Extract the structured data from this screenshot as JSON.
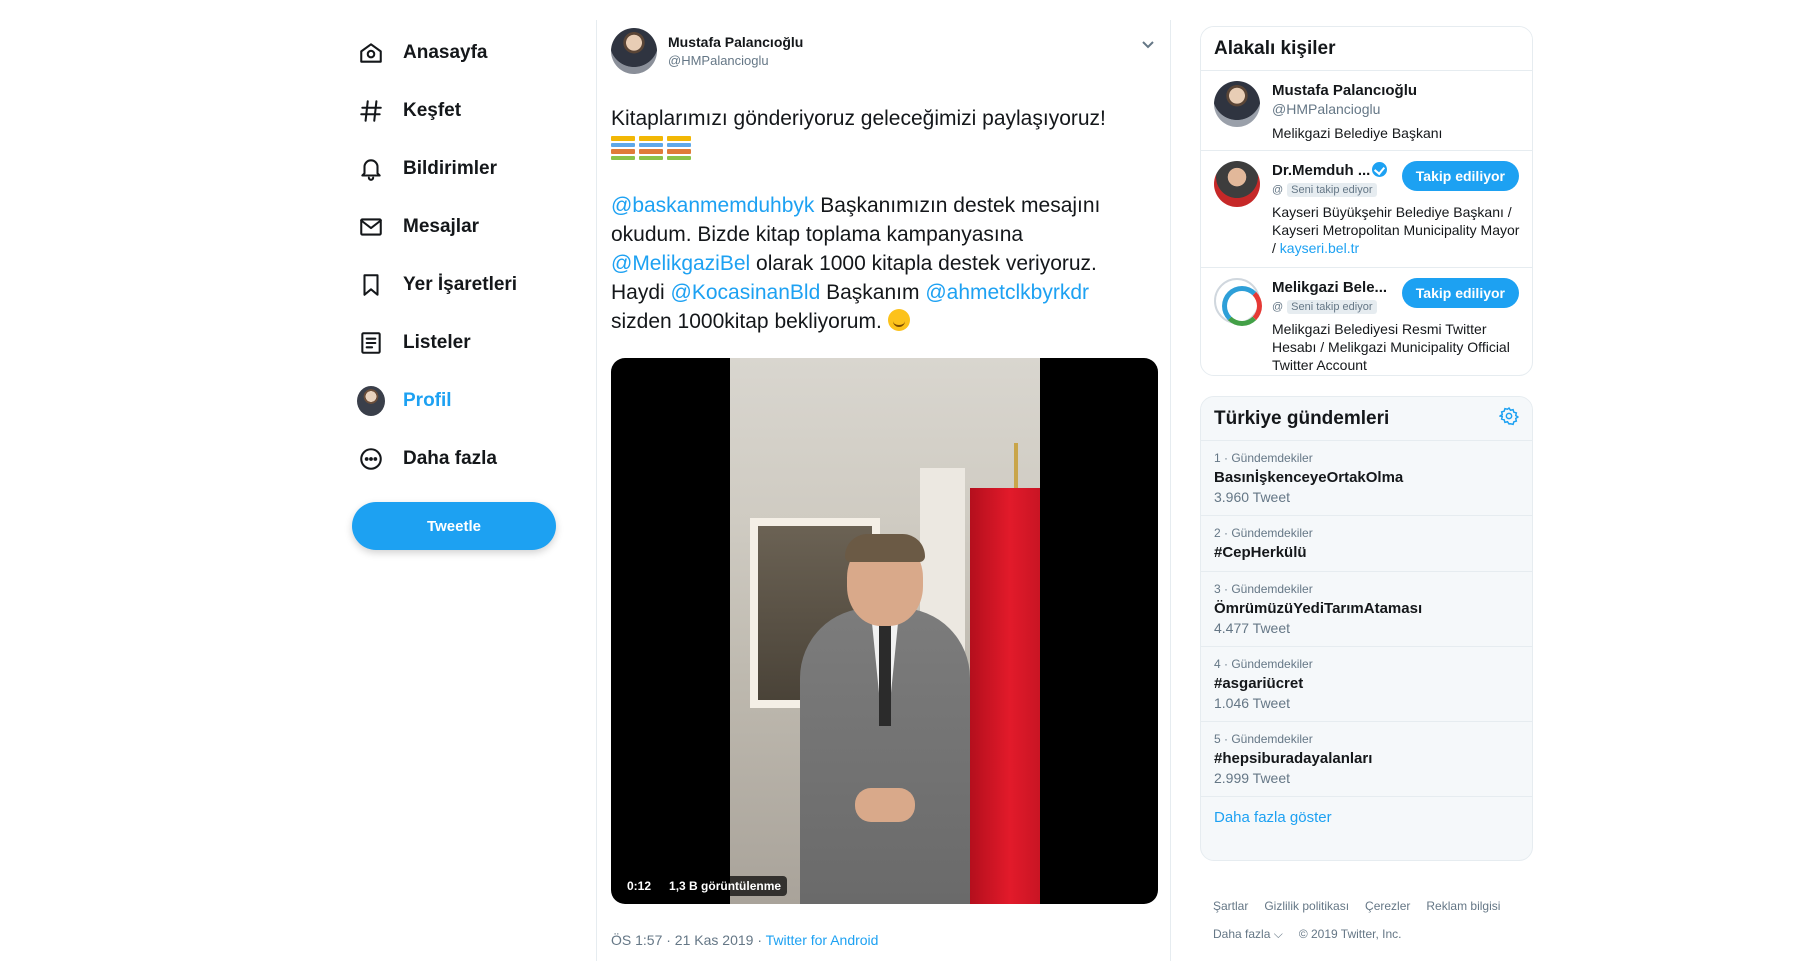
{
  "nav": {
    "items": [
      {
        "label": "Anasayfa",
        "icon": "home-icon"
      },
      {
        "label": "Keşfet",
        "icon": "hashtag-icon"
      },
      {
        "label": "Bildirimler",
        "icon": "bell-icon"
      },
      {
        "label": "Mesajlar",
        "icon": "mail-icon"
      },
      {
        "label": "Yer İşaretleri",
        "icon": "bookmark-icon"
      },
      {
        "label": "Listeler",
        "icon": "list-icon"
      },
      {
        "label": "Profil",
        "icon": "avatar"
      },
      {
        "label": "Daha fazla",
        "icon": "more-icon"
      }
    ],
    "tweet_button": "Tweetle",
    "active_color": "#1da1f2"
  },
  "tweet": {
    "name": "Mustafa Palancıoğlu",
    "handle": "@HMPalancioglu",
    "line1": "Kitaplarımızı gönderiyoruz geleceğimizi paylaşıyoruz!",
    "mention1": "@baskanmemduhbyk",
    "t1": " Başkanımızın destek mesajını okudum. Bizde kitap toplama kampanyasına ",
    "mention2": "@MelikgaziBel",
    "t2": " olarak 1000 kitapla destek veriyoruz. Haydi ",
    "mention3": "@KocasinanBld",
    "t3": " Başkanım ",
    "mention4": "@ahmetclkbyrkdr",
    "t4": " sizden 1000kitap bekliyorum. ",
    "video_time": "0:12",
    "video_views": "1,3 B görüntülenme",
    "timestamp": "ÖS 1:57 · 21 Kas 2019 · ",
    "source": "Twitter for Android"
  },
  "related": {
    "title": "Alakalı kişiler",
    "people": [
      {
        "name": "Mustafa Palancıoğlu",
        "handle": "@HMPalancioglu",
        "bio": "Melikgazi Belediye Başkanı"
      },
      {
        "name": "Dr.Memduh ...",
        "at": "@",
        "follows_you": "Seni takip ediyor",
        "button": "Takip ediliyor",
        "bio": "Kayseri Büyükşehir Belediye Başkanı / Kayseri Metropolitan Municipality Mayor / ",
        "link": "kayseri.bel.tr"
      },
      {
        "name": "Melikgazi Bele...",
        "at": "@",
        "follows_you": "Seni takip ediyor",
        "button": "Takip ediliyor",
        "bio": "Melikgazi Belediyesi Resmi Twitter Hesabı / Melikgazi Municipality Official Twitter Account"
      }
    ]
  },
  "trends": {
    "title": "Türkiye gündemleri",
    "items": [
      {
        "meta": "1 · Gündemdekiler",
        "name": "BasınİşkenceyeOrtakOlma",
        "count": "3.960 Tweet"
      },
      {
        "meta": "2 · Gündemdekiler",
        "name": "#CepHerkülü",
        "count": ""
      },
      {
        "meta": "3 · Gündemdekiler",
        "name": "ÖmrümüzüYediTarımAtaması",
        "count": "4.477 Tweet"
      },
      {
        "meta": "4 · Gündemdekiler",
        "name": "#asgariücret",
        "count": "1.046 Tweet"
      },
      {
        "meta": "5 · Gündemdekiler",
        "name": "#hepsiburadayalanları",
        "count": "2.999 Tweet"
      }
    ],
    "show_more": "Daha fazla göster"
  },
  "footer": {
    "links": [
      "Şartlar",
      "Gizlilik politikası",
      "Çerezler",
      "Reklam bilgisi"
    ],
    "more": "Daha fazla ⌵",
    "copyright": "© 2019 Twitter, Inc."
  }
}
